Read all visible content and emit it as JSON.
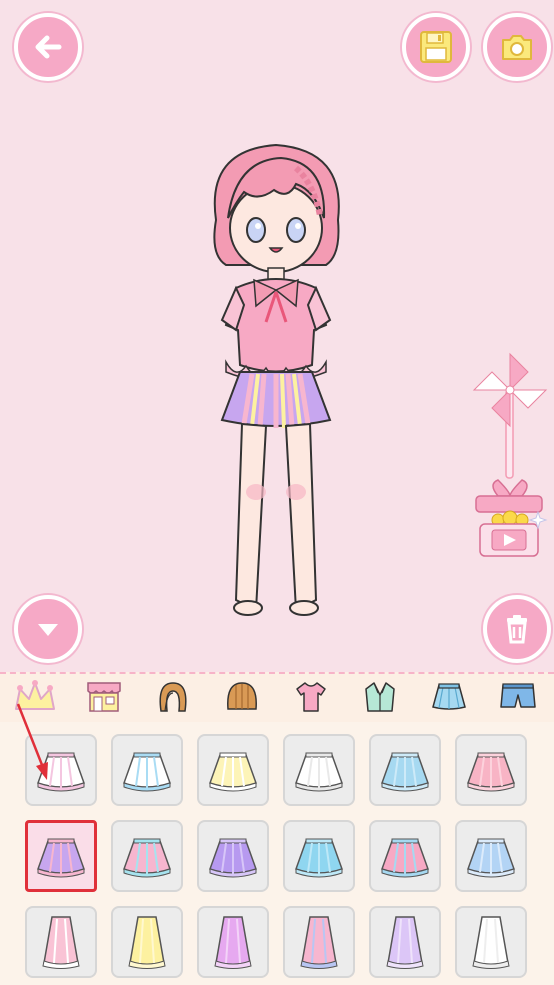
{
  "toolbar": {
    "back_icon": "arrow-left-icon",
    "save_icon": "floppy-disk-icon",
    "camera_icon": "camera-icon",
    "collapse_icon": "chevron-down-icon",
    "delete_icon": "trash-icon"
  },
  "colors": {
    "background": "#f8e1e8",
    "button_pink": "#f6a9c6",
    "icon_yellow": "#fbe97c",
    "category_bar": "#fcefe4",
    "panel": "#fcf3ea",
    "selection_border": "#e0303a"
  },
  "categories": [
    {
      "name": "crown",
      "icon": "crown-icon"
    },
    {
      "name": "shop",
      "icon": "shop-icon"
    },
    {
      "name": "back-hair",
      "icon": "back-hair-icon"
    },
    {
      "name": "front-hair",
      "icon": "front-hair-icon"
    },
    {
      "name": "top",
      "icon": "tshirt-icon"
    },
    {
      "name": "jacket",
      "icon": "jacket-icon"
    },
    {
      "name": "skirt",
      "icon": "skirt-icon"
    },
    {
      "name": "shorts",
      "icon": "shorts-icon"
    }
  ],
  "items": [
    {
      "name": "lace-skirt",
      "colors": [
        "#ffffff",
        "#f4c6e0"
      ],
      "selected": false
    },
    {
      "name": "bow-skirt",
      "colors": [
        "#ffffff",
        "#a9dcf4"
      ],
      "selected": false
    },
    {
      "name": "yellow-button-skirt",
      "colors": [
        "#fdf4b8",
        "#ffffff"
      ],
      "selected": false
    },
    {
      "name": "white-asymmetric-skirt",
      "colors": [
        "#ffffff",
        "#e9e9e9"
      ],
      "selected": false
    },
    {
      "name": "blue-flared-skirt",
      "colors": [
        "#a6d9f1",
        "#cdeaf8"
      ],
      "selected": false
    },
    {
      "name": "pink-skirt",
      "colors": [
        "#f8b4c5",
        "#fcd2dc"
      ],
      "selected": false
    },
    {
      "name": "rainbow-pleated-skirt",
      "colors": [
        "#c7a6ef",
        "#f7b6cf"
      ],
      "selected": true
    },
    {
      "name": "pastel-layer-skirt",
      "colors": [
        "#f7b6cf",
        "#a6e3ef"
      ],
      "selected": false
    },
    {
      "name": "purple-flower-skirt",
      "colors": [
        "#b79af0",
        "#d7c6f8"
      ],
      "selected": false
    },
    {
      "name": "blue-pleated-skirt",
      "colors": [
        "#8fd6f0",
        "#bde8f7"
      ],
      "selected": false
    },
    {
      "name": "pink-blue-skirt",
      "colors": [
        "#f7a9c4",
        "#a6d9f1"
      ],
      "selected": false
    },
    {
      "name": "blue-star-skirt",
      "colors": [
        "#b3d4f5",
        "#dcebfb"
      ],
      "selected": false
    },
    {
      "name": "pink-long-skirt",
      "colors": [
        "#f9c3d5",
        "#ffffff"
      ],
      "selected": false
    },
    {
      "name": "yellow-long-skirt",
      "colors": [
        "#fdf1a0",
        "#fff8d0"
      ],
      "selected": false
    },
    {
      "name": "purple-mermaid-skirt",
      "colors": [
        "#e6a9f0",
        "#f3d3f8"
      ],
      "selected": false
    },
    {
      "name": "pink-striped-long-skirt",
      "colors": [
        "#f7b6cf",
        "#b8c6f3"
      ],
      "selected": false
    },
    {
      "name": "lilac-tutu-skirt",
      "colors": [
        "#dcc6f7",
        "#efe3fb"
      ],
      "selected": false
    },
    {
      "name": "white-long-skirt",
      "colors": [
        "#ffffff",
        "#eeeeee"
      ],
      "selected": false
    }
  ]
}
